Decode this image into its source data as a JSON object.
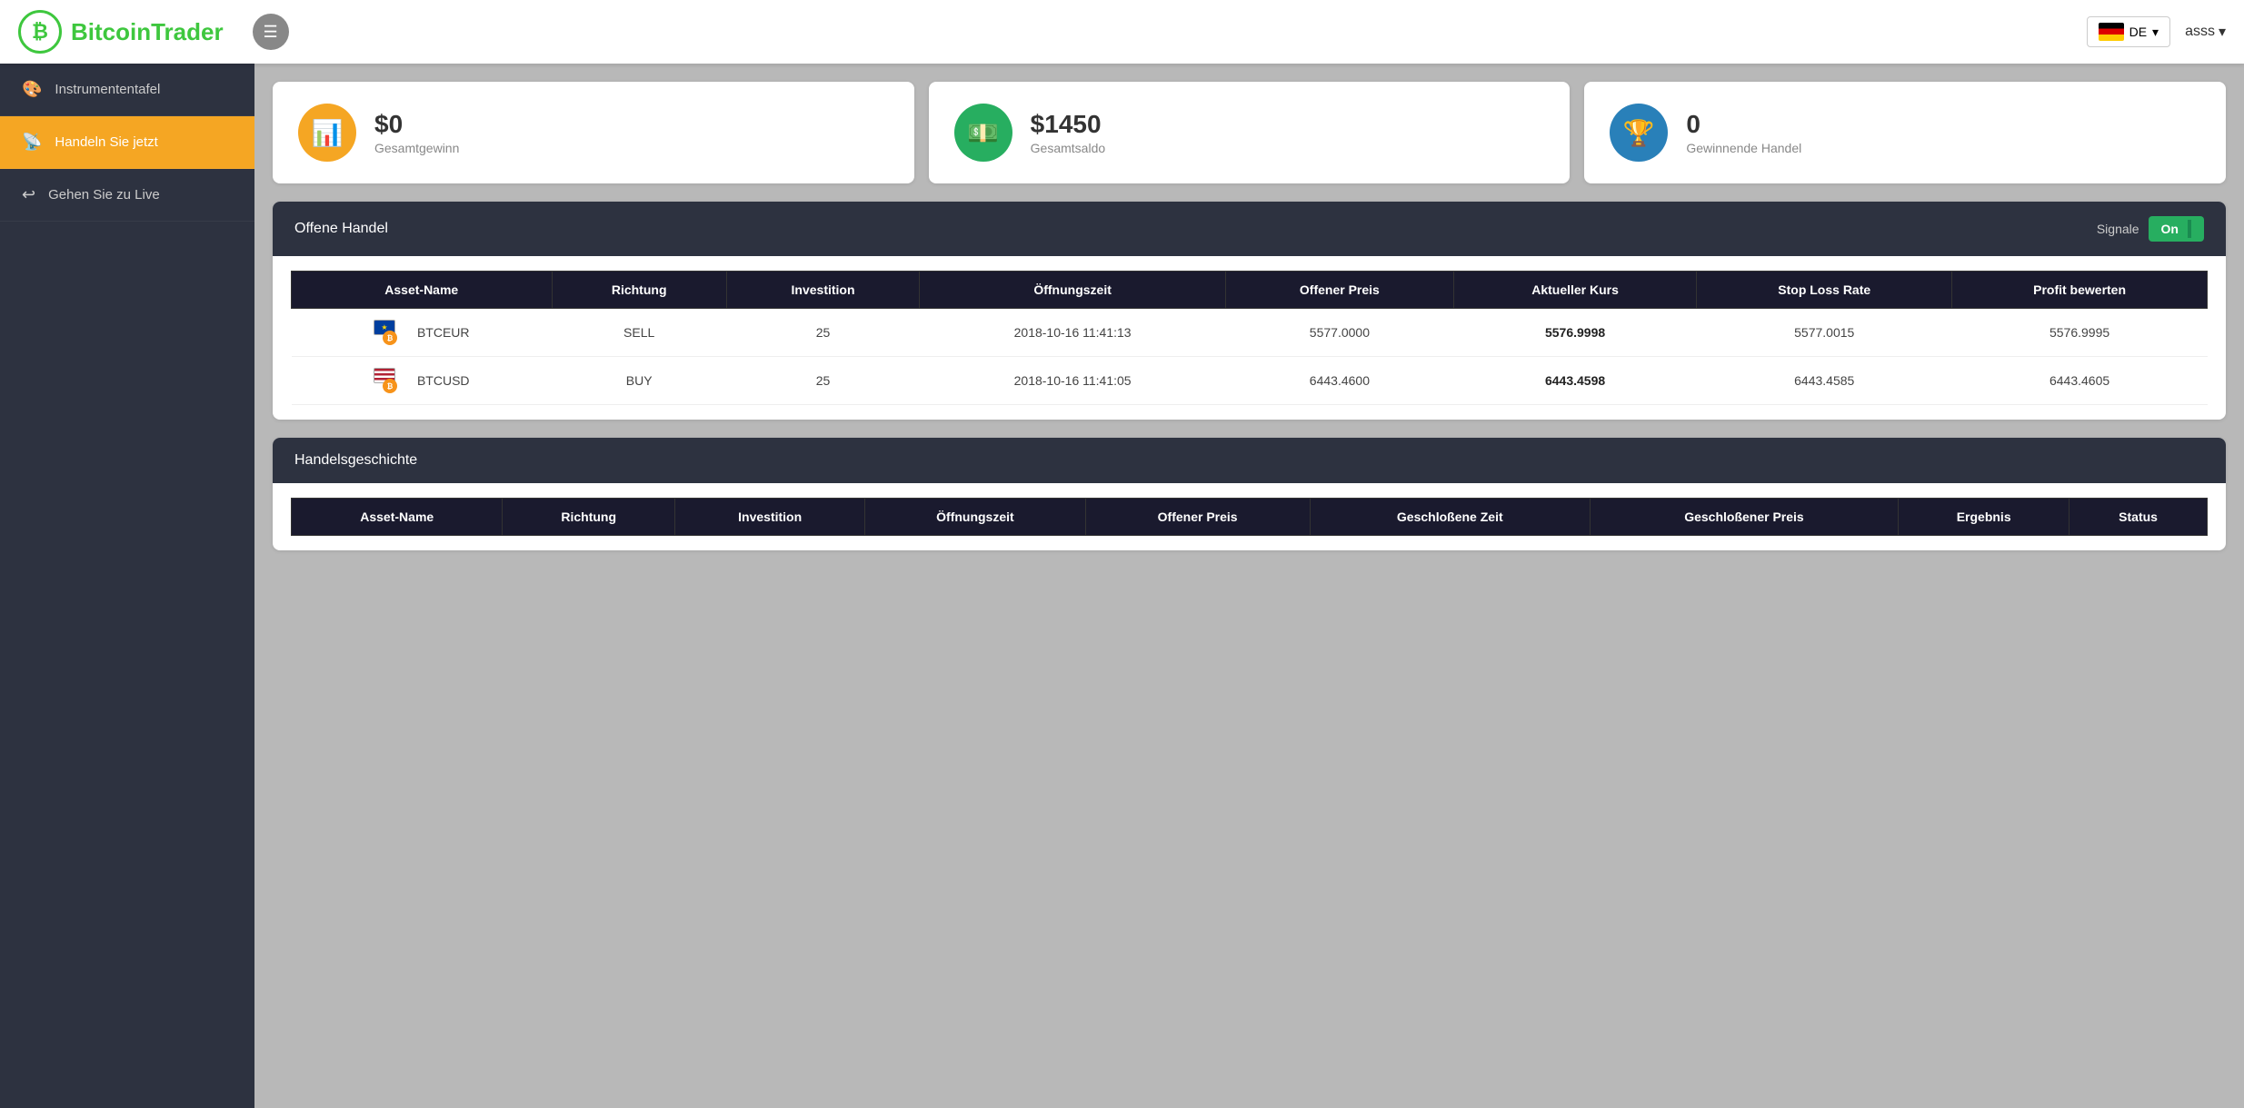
{
  "header": {
    "logo_text_plain": "Bitcoin",
    "logo_text_brand": "Trader",
    "menu_label": "☰",
    "lang_label": "DE",
    "user_name": "asss",
    "chevron": "▾"
  },
  "sidebar": {
    "items": [
      {
        "id": "instrumententafel",
        "label": "Instrumententafel",
        "icon": "🎨",
        "active": false
      },
      {
        "id": "handeln",
        "label": "Handeln Sie jetzt",
        "icon": "📡",
        "active": true
      },
      {
        "id": "live",
        "label": "Gehen Sie zu Live",
        "icon": "↩",
        "active": false
      }
    ]
  },
  "stats": [
    {
      "id": "total-profit",
      "icon": "📊",
      "icon_class": "yellow",
      "value": "$0",
      "label": "Gesamtgewinn"
    },
    {
      "id": "total-balance",
      "icon": "💵",
      "icon_class": "green",
      "value": "$1450",
      "label": "Gesamtsaldo"
    },
    {
      "id": "winning-trades",
      "icon": "🏆",
      "icon_class": "blue",
      "value": "0",
      "label": "Gewinnende Handel"
    }
  ],
  "open_trades": {
    "section_title": "Offene Handel",
    "signals_label": "Signale",
    "toggle_label": "On",
    "columns": [
      "Asset-Name",
      "Richtung",
      "Investition",
      "Öffnungszeit",
      "Offener Preis",
      "Aktueller Kurs",
      "Stop Loss Rate",
      "Profit bewerten"
    ],
    "rows": [
      {
        "asset": "BTCEUR",
        "direction": "SELL",
        "investment": "25",
        "opening_time": "2018-10-16 11:41:13",
        "open_price": "5577.0000",
        "current_rate": "5576.9998",
        "stop_loss": "5577.0015",
        "profit": "5576.9995",
        "flag_type": "eu"
      },
      {
        "asset": "BTCUSD",
        "direction": "BUY",
        "investment": "25",
        "opening_time": "2018-10-16 11:41:05",
        "open_price": "6443.4600",
        "current_rate": "6443.4598",
        "stop_loss": "6443.4585",
        "profit": "6443.4605",
        "flag_type": "us"
      }
    ]
  },
  "trade_history": {
    "section_title": "Handelsgeschichte",
    "columns": [
      "Asset-Name",
      "Richtung",
      "Investition",
      "Öffnungszeit",
      "Offener Preis",
      "Geschloßene Zeit",
      "Geschloßener Preis",
      "Ergebnis",
      "Status"
    ]
  }
}
